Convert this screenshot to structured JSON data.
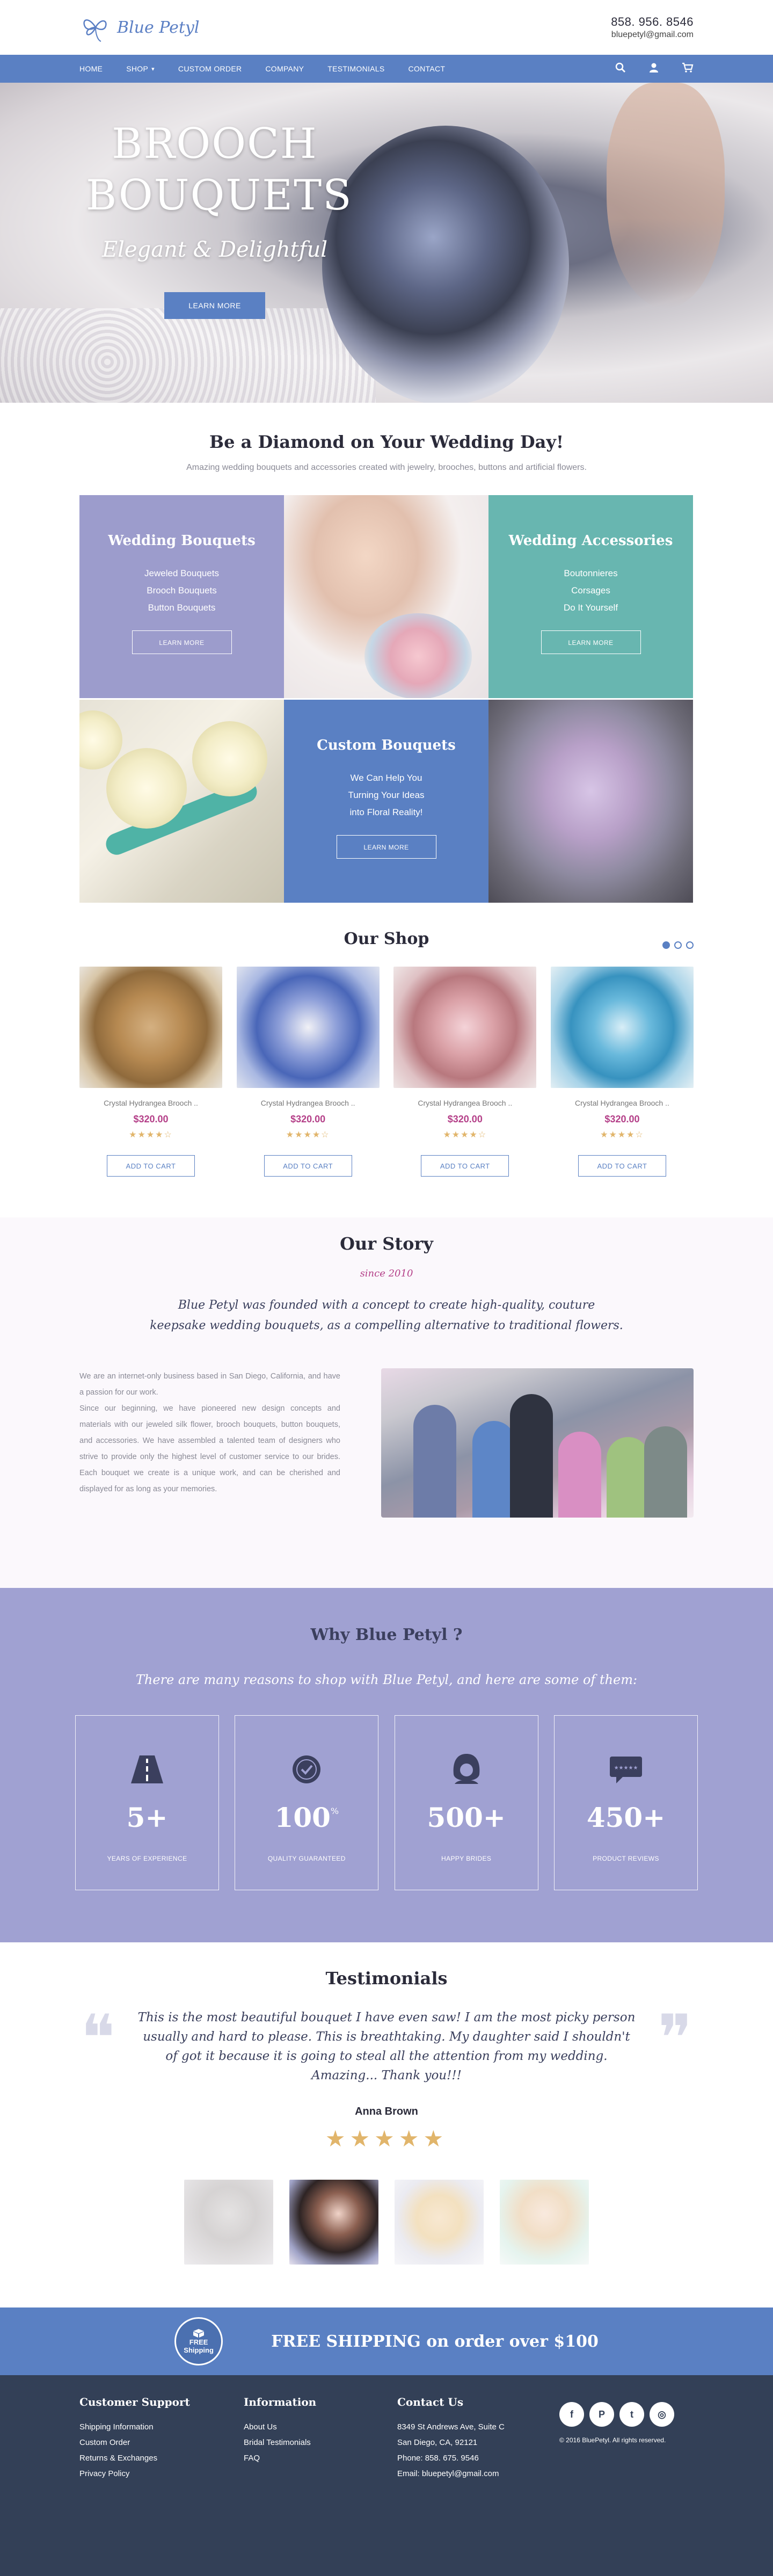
{
  "header": {
    "brand": "Blue Petyl",
    "phone": "858. 956. 8546",
    "email": "bluepetyl@gmail.com"
  },
  "nav": {
    "items": [
      {
        "label": "HOME"
      },
      {
        "label": "SHOP"
      },
      {
        "label": "CUSTOM ORDER"
      },
      {
        "label": "COMPANY"
      },
      {
        "label": "TESTIMONIALS"
      },
      {
        "label": "CONTACT"
      }
    ],
    "shop_caret": "▾",
    "icons": [
      "search-icon",
      "user-icon",
      "cart-icon"
    ]
  },
  "hero": {
    "title_line1": "BROOCH",
    "title_line2": "BOUQUETS",
    "subtitle": "Elegant & Delightful",
    "button": "LEARN MORE"
  },
  "intro": {
    "title": "Be a Diamond on Your Wedding Day!",
    "text": "Amazing wedding bouquets and accessories created with jewelry, brooches, buttons and artificial flowers."
  },
  "tiles": {
    "bouquets": {
      "title": "Wedding Bouquets",
      "items": [
        "Jeweled Bouquets",
        "Brooch Bouquets",
        "Button Bouquets"
      ],
      "button": "LEARN MORE"
    },
    "accessories": {
      "title": "Wedding Accessories",
      "items": [
        "Boutonnieres",
        "Corsages",
        "Do It Yourself"
      ],
      "button": "LEARN MORE"
    },
    "custom": {
      "title": "Custom Bouquets",
      "items": [
        "We Can Help You",
        "Turning Your Ideas",
        "into Floral Reality!"
      ],
      "button": "LEARN MORE"
    }
  },
  "shop": {
    "title": "Our Shop",
    "products": [
      {
        "name": "Crystal Hydrangea Brooch ..",
        "price": "$320.00",
        "stars": "★★★★☆",
        "button": "ADD TO CART"
      },
      {
        "name": "Crystal Hydrangea Brooch ..",
        "price": "$320.00",
        "stars": "★★★★☆",
        "button": "ADD TO CART"
      },
      {
        "name": "Crystal Hydrangea Brooch ..",
        "price": "$320.00",
        "stars": "★★★★☆",
        "button": "ADD TO CART"
      },
      {
        "name": "Crystal Hydrangea Brooch ..",
        "price": "$320.00",
        "stars": "★★★★☆",
        "button": "ADD TO CART"
      }
    ]
  },
  "story": {
    "title": "Our Story",
    "since": "since 2010",
    "quote_line1": "Blue Petyl was founded with a concept to create high-quality, couture",
    "quote_line2": "keepsake wedding bouquets, as a compelling alternative to traditional flowers.",
    "paragraph1": "We are an internet-only business based in San Diego, California, and have a passion for our work.",
    "paragraph2": "Since our beginning, we have pioneered new design concepts and materials with our jeweled silk flower, brooch bouquets, button bouquets, and accessories. We have assembled a talented team of designers who strive to provide only the highest level of customer service to our brides. Each bouquet we create is a unique work, and can be cherished and displayed for as long as your memories."
  },
  "why": {
    "title": "Why Blue Petyl ?",
    "intro": "There are many reasons to shop with Blue Petyl, and here are some of them:",
    "stats": [
      {
        "icon": "road-icon",
        "value": "5+",
        "suffix": "",
        "label": "YEARS OF EXPERIENCE"
      },
      {
        "icon": "quality-badge-icon",
        "value": "100",
        "suffix": "%",
        "label": "QUALITY GUARANTEED"
      },
      {
        "icon": "bride-icon",
        "value": "500+",
        "suffix": "",
        "label": "HAPPY BRIDES"
      },
      {
        "icon": "review-icon",
        "value": "450+",
        "suffix": "",
        "label": "PRODUCT REVIEWS"
      }
    ]
  },
  "testimonials": {
    "title": "Testimonials",
    "text": "This is the most beautiful bouquet I have even saw! I am the most picky person usually and hard to please. This is breathtaking. My daughter said I shouldn't of got it because it is going to steal all the attention from my wedding. Amazing... Thank you!!!",
    "author": "Anna Brown",
    "stars": "★★★★★"
  },
  "shipping": {
    "badge_line1": "FREE",
    "badge_line2": "Shipping",
    "message": "FREE SHIPPING on order over $100"
  },
  "footer": {
    "support": {
      "title": "Customer Support",
      "links": [
        "Shipping Information",
        "Custom Order",
        "Returns & Exchanges",
        "Privacy Policy"
      ]
    },
    "information": {
      "title": "Information",
      "links": [
        "About Us",
        "Bridal Testimonials",
        "FAQ"
      ]
    },
    "contact": {
      "title": "Contact Us",
      "lines": [
        "8349 St Andrews Ave, Suite C",
        "San Diego, CA, 92121",
        "Phone: 858. 675. 9546",
        "Email: bluepetyl@gmail.com"
      ]
    },
    "social": [
      "f",
      "P",
      "t",
      "◎"
    ],
    "copyright": "© 2016 BluePetyl. All rights reserved."
  },
  "colors": {
    "brand_blue": "#5a80c3",
    "purple": "#9c9ccc",
    "teal": "#68b6b0",
    "price": "#b43f88",
    "star": "#e1b56b",
    "footer": "#334057"
  }
}
